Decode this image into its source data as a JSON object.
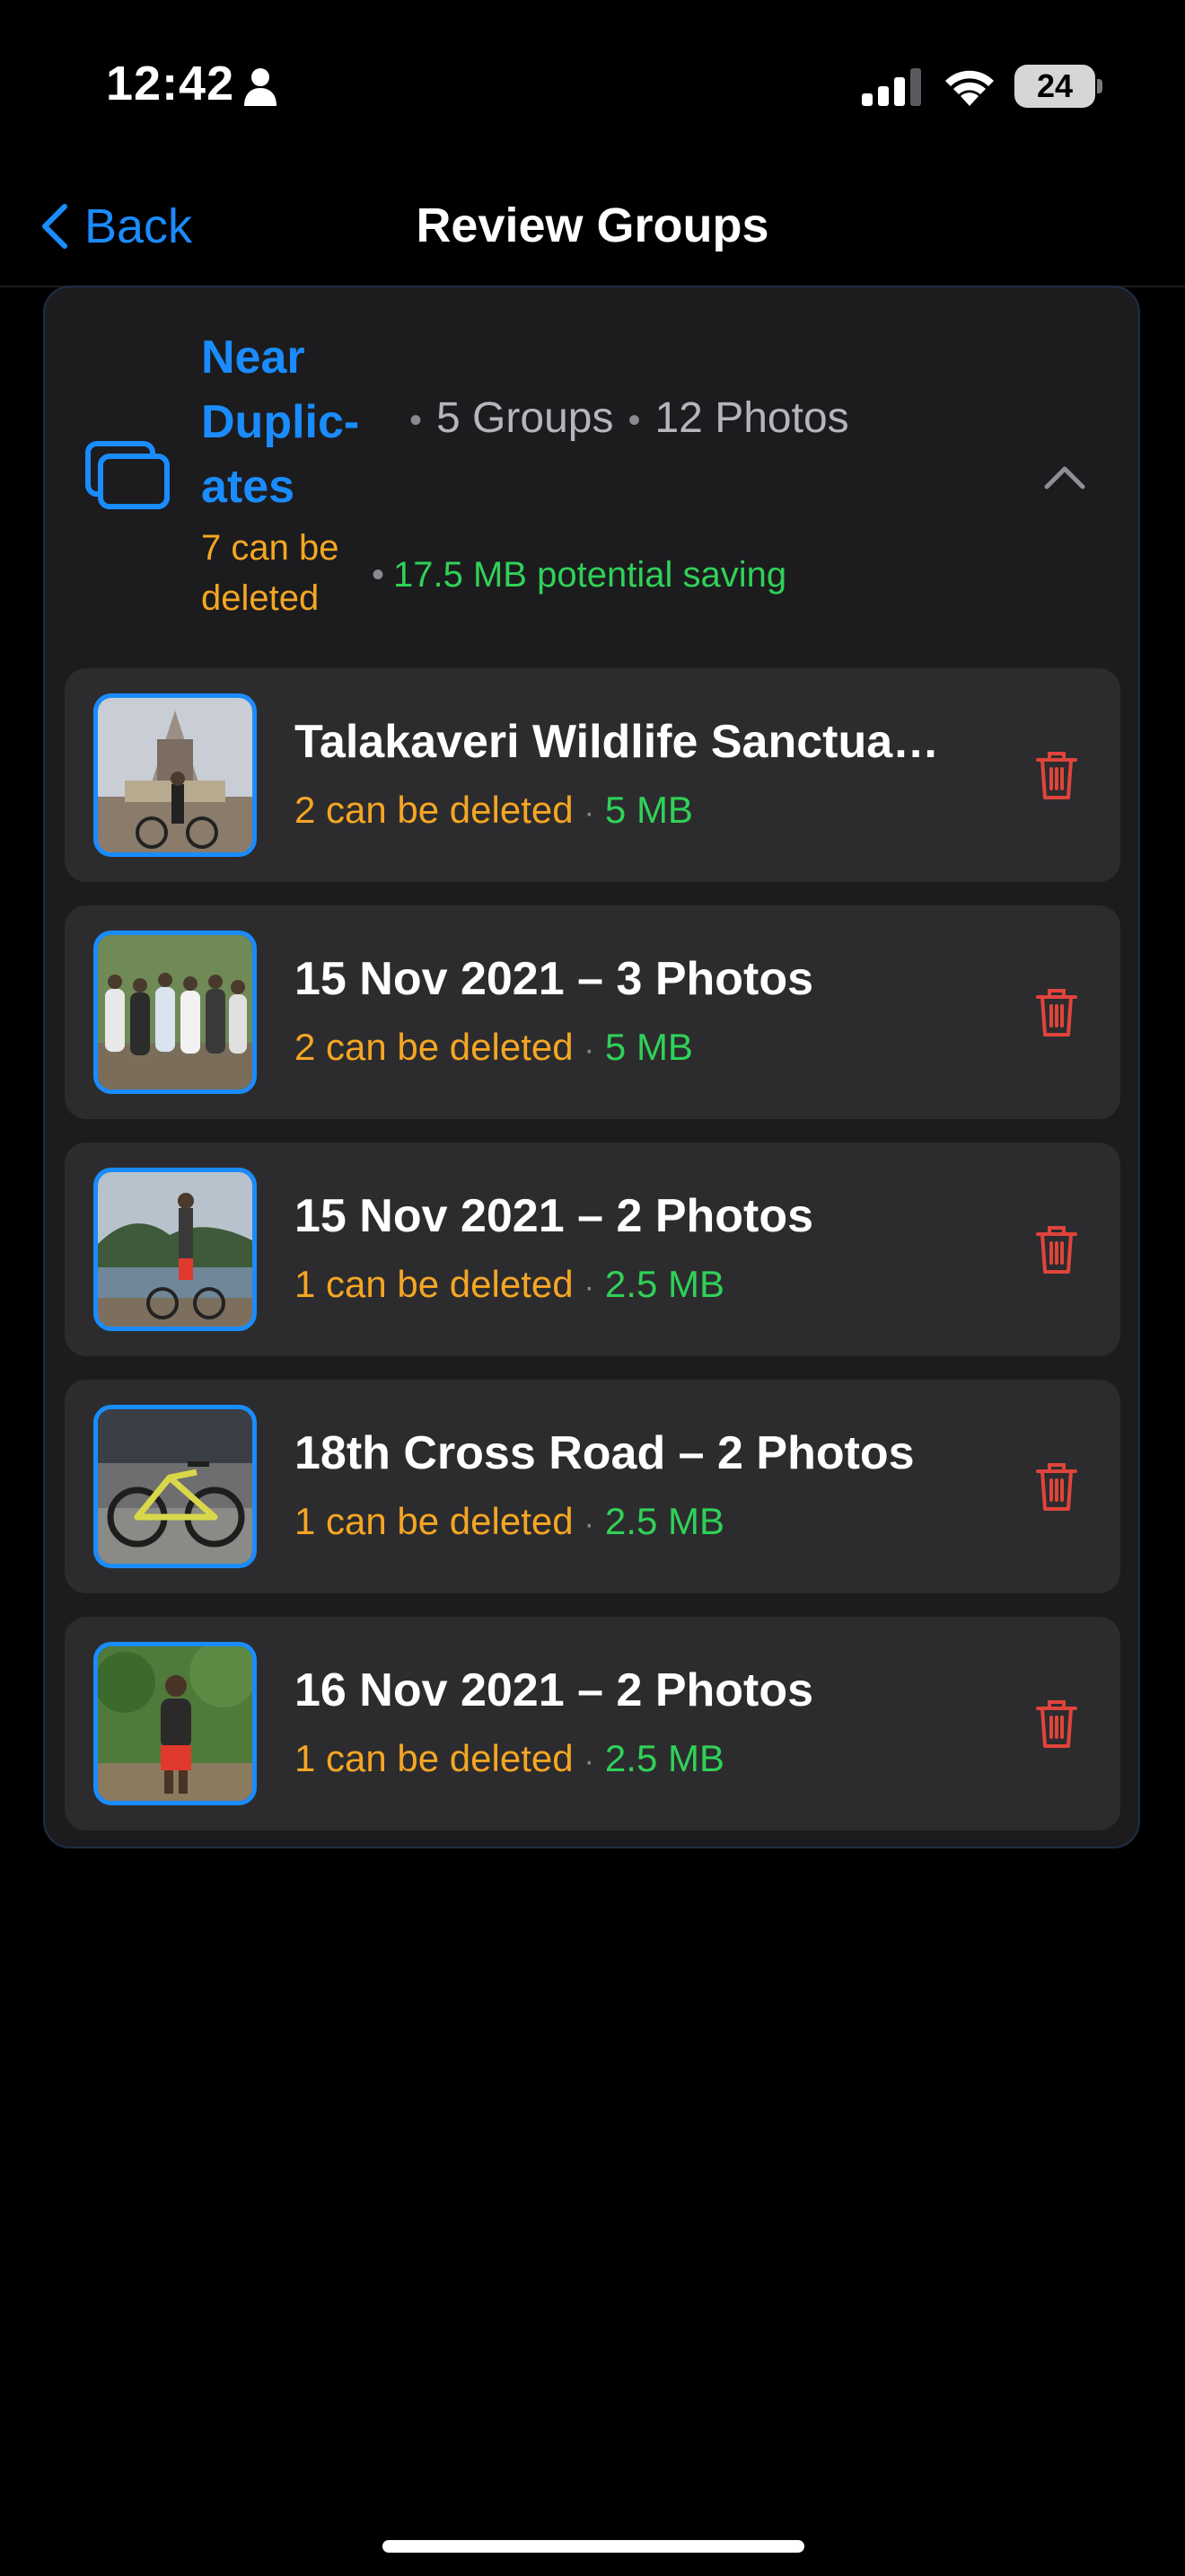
{
  "status_bar": {
    "time": "12:42",
    "battery": "24"
  },
  "nav": {
    "back_label": "Back",
    "title": "Review Groups"
  },
  "card": {
    "title": "Near Duplic- ates",
    "groups_count": "5 Groups",
    "photos_count": "12 Photos",
    "deletable": "7 can be deleted",
    "saving_amount": "17.5 MB",
    "saving_label": "potential saving"
  },
  "groups": [
    {
      "title": "Talakaveri Wildlife Sanctuar...",
      "deletable": "2 can be deleted",
      "size": "5 MB"
    },
    {
      "title": "15 Nov 2021 – 3 Photos",
      "deletable": "2 can be deleted",
      "size": "5 MB"
    },
    {
      "title": "15 Nov 2021 – 2 Photos",
      "deletable": "1 can be deleted",
      "size": "2.5 MB"
    },
    {
      "title": "18th Cross Road – 2 Photos",
      "deletable": "1 can be deleted",
      "size": "2.5 MB"
    },
    {
      "title": "16 Nov 2021 – 2 Photos",
      "deletable": "1 can be deleted",
      "size": "2.5 MB"
    }
  ],
  "colors": {
    "accent": "#1a8cff",
    "warning": "#f5a623",
    "success": "#30d158",
    "danger": "#e0443b"
  }
}
